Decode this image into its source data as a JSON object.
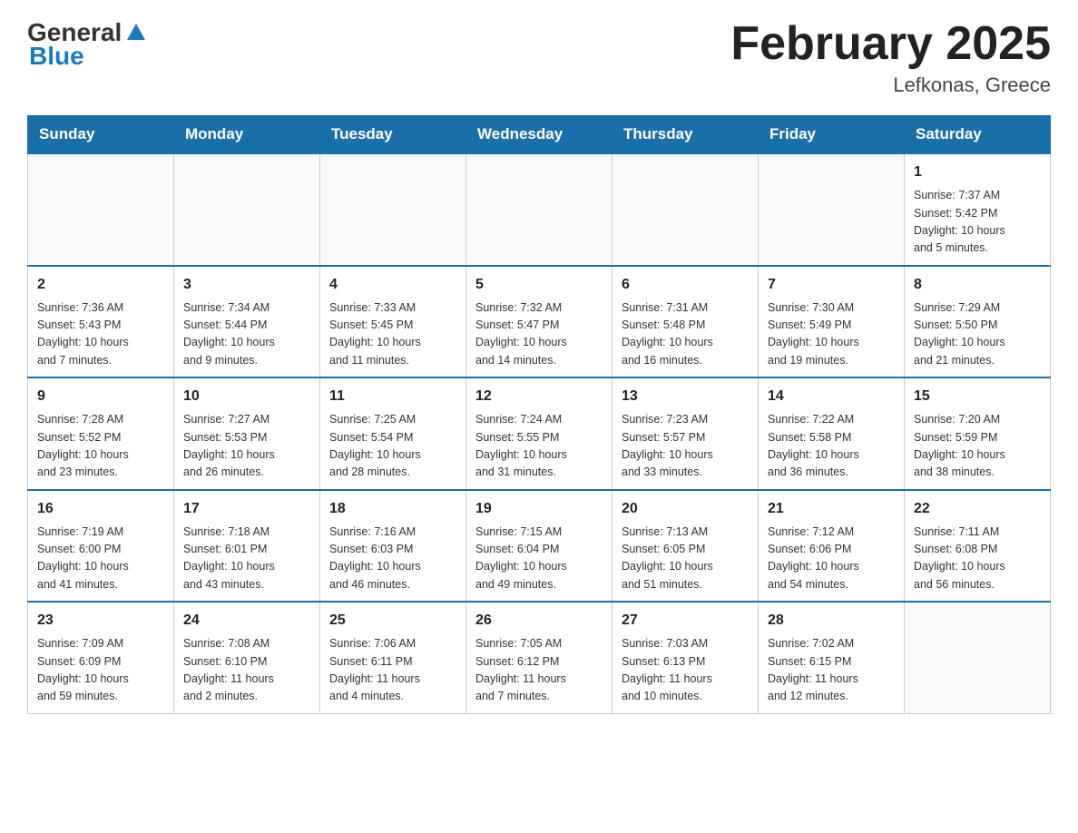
{
  "header": {
    "logo": {
      "general": "General",
      "blue": "Blue"
    },
    "title": "February 2025",
    "location": "Lefkonas, Greece"
  },
  "days_of_week": [
    "Sunday",
    "Monday",
    "Tuesday",
    "Wednesday",
    "Thursday",
    "Friday",
    "Saturday"
  ],
  "weeks": [
    [
      {
        "day": "",
        "info": ""
      },
      {
        "day": "",
        "info": ""
      },
      {
        "day": "",
        "info": ""
      },
      {
        "day": "",
        "info": ""
      },
      {
        "day": "",
        "info": ""
      },
      {
        "day": "",
        "info": ""
      },
      {
        "day": "1",
        "info": "Sunrise: 7:37 AM\nSunset: 5:42 PM\nDaylight: 10 hours\nand 5 minutes."
      }
    ],
    [
      {
        "day": "2",
        "info": "Sunrise: 7:36 AM\nSunset: 5:43 PM\nDaylight: 10 hours\nand 7 minutes."
      },
      {
        "day": "3",
        "info": "Sunrise: 7:34 AM\nSunset: 5:44 PM\nDaylight: 10 hours\nand 9 minutes."
      },
      {
        "day": "4",
        "info": "Sunrise: 7:33 AM\nSunset: 5:45 PM\nDaylight: 10 hours\nand 11 minutes."
      },
      {
        "day": "5",
        "info": "Sunrise: 7:32 AM\nSunset: 5:47 PM\nDaylight: 10 hours\nand 14 minutes."
      },
      {
        "day": "6",
        "info": "Sunrise: 7:31 AM\nSunset: 5:48 PM\nDaylight: 10 hours\nand 16 minutes."
      },
      {
        "day": "7",
        "info": "Sunrise: 7:30 AM\nSunset: 5:49 PM\nDaylight: 10 hours\nand 19 minutes."
      },
      {
        "day": "8",
        "info": "Sunrise: 7:29 AM\nSunset: 5:50 PM\nDaylight: 10 hours\nand 21 minutes."
      }
    ],
    [
      {
        "day": "9",
        "info": "Sunrise: 7:28 AM\nSunset: 5:52 PM\nDaylight: 10 hours\nand 23 minutes."
      },
      {
        "day": "10",
        "info": "Sunrise: 7:27 AM\nSunset: 5:53 PM\nDaylight: 10 hours\nand 26 minutes."
      },
      {
        "day": "11",
        "info": "Sunrise: 7:25 AM\nSunset: 5:54 PM\nDaylight: 10 hours\nand 28 minutes."
      },
      {
        "day": "12",
        "info": "Sunrise: 7:24 AM\nSunset: 5:55 PM\nDaylight: 10 hours\nand 31 minutes."
      },
      {
        "day": "13",
        "info": "Sunrise: 7:23 AM\nSunset: 5:57 PM\nDaylight: 10 hours\nand 33 minutes."
      },
      {
        "day": "14",
        "info": "Sunrise: 7:22 AM\nSunset: 5:58 PM\nDaylight: 10 hours\nand 36 minutes."
      },
      {
        "day": "15",
        "info": "Sunrise: 7:20 AM\nSunset: 5:59 PM\nDaylight: 10 hours\nand 38 minutes."
      }
    ],
    [
      {
        "day": "16",
        "info": "Sunrise: 7:19 AM\nSunset: 6:00 PM\nDaylight: 10 hours\nand 41 minutes."
      },
      {
        "day": "17",
        "info": "Sunrise: 7:18 AM\nSunset: 6:01 PM\nDaylight: 10 hours\nand 43 minutes."
      },
      {
        "day": "18",
        "info": "Sunrise: 7:16 AM\nSunset: 6:03 PM\nDaylight: 10 hours\nand 46 minutes."
      },
      {
        "day": "19",
        "info": "Sunrise: 7:15 AM\nSunset: 6:04 PM\nDaylight: 10 hours\nand 49 minutes."
      },
      {
        "day": "20",
        "info": "Sunrise: 7:13 AM\nSunset: 6:05 PM\nDaylight: 10 hours\nand 51 minutes."
      },
      {
        "day": "21",
        "info": "Sunrise: 7:12 AM\nSunset: 6:06 PM\nDaylight: 10 hours\nand 54 minutes."
      },
      {
        "day": "22",
        "info": "Sunrise: 7:11 AM\nSunset: 6:08 PM\nDaylight: 10 hours\nand 56 minutes."
      }
    ],
    [
      {
        "day": "23",
        "info": "Sunrise: 7:09 AM\nSunset: 6:09 PM\nDaylight: 10 hours\nand 59 minutes."
      },
      {
        "day": "24",
        "info": "Sunrise: 7:08 AM\nSunset: 6:10 PM\nDaylight: 11 hours\nand 2 minutes."
      },
      {
        "day": "25",
        "info": "Sunrise: 7:06 AM\nSunset: 6:11 PM\nDaylight: 11 hours\nand 4 minutes."
      },
      {
        "day": "26",
        "info": "Sunrise: 7:05 AM\nSunset: 6:12 PM\nDaylight: 11 hours\nand 7 minutes."
      },
      {
        "day": "27",
        "info": "Sunrise: 7:03 AM\nSunset: 6:13 PM\nDaylight: 11 hours\nand 10 minutes."
      },
      {
        "day": "28",
        "info": "Sunrise: 7:02 AM\nSunset: 6:15 PM\nDaylight: 11 hours\nand 12 minutes."
      },
      {
        "day": "",
        "info": ""
      }
    ]
  ]
}
